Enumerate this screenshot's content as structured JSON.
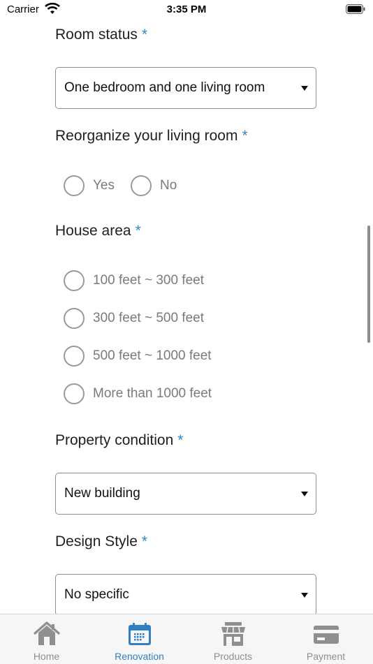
{
  "status_bar": {
    "carrier": "Carrier",
    "time": "3:35 PM"
  },
  "form": {
    "required_mark": "*",
    "room_status": {
      "label": "Room status",
      "value": "One bedroom and one living room"
    },
    "reorganize": {
      "label": "Reorganize your living room",
      "options": [
        "Yes",
        "No"
      ],
      "selected": null
    },
    "house_area": {
      "label": "House area",
      "options": [
        "100 feet ~ 300 feet",
        "300 feet ~ 500 feet",
        "500 feet ~ 1000 feet",
        "More than 1000 feet"
      ],
      "selected": null
    },
    "property_condition": {
      "label": "Property condition",
      "value": "New building"
    },
    "design_style": {
      "label": "Design Style",
      "value": "No specific"
    }
  },
  "tab_bar": {
    "active_index": 1,
    "tabs": [
      {
        "label": "Home",
        "icon": "home-icon"
      },
      {
        "label": "Renovation",
        "icon": "calendar-icon"
      },
      {
        "label": "Products",
        "icon": "store-icon"
      },
      {
        "label": "Payment",
        "icon": "credit-card-icon"
      }
    ]
  },
  "colors": {
    "accent": "#2f7fc1",
    "asterisk": "#2f86c7",
    "inactive_tab": "#8f8f8f"
  }
}
